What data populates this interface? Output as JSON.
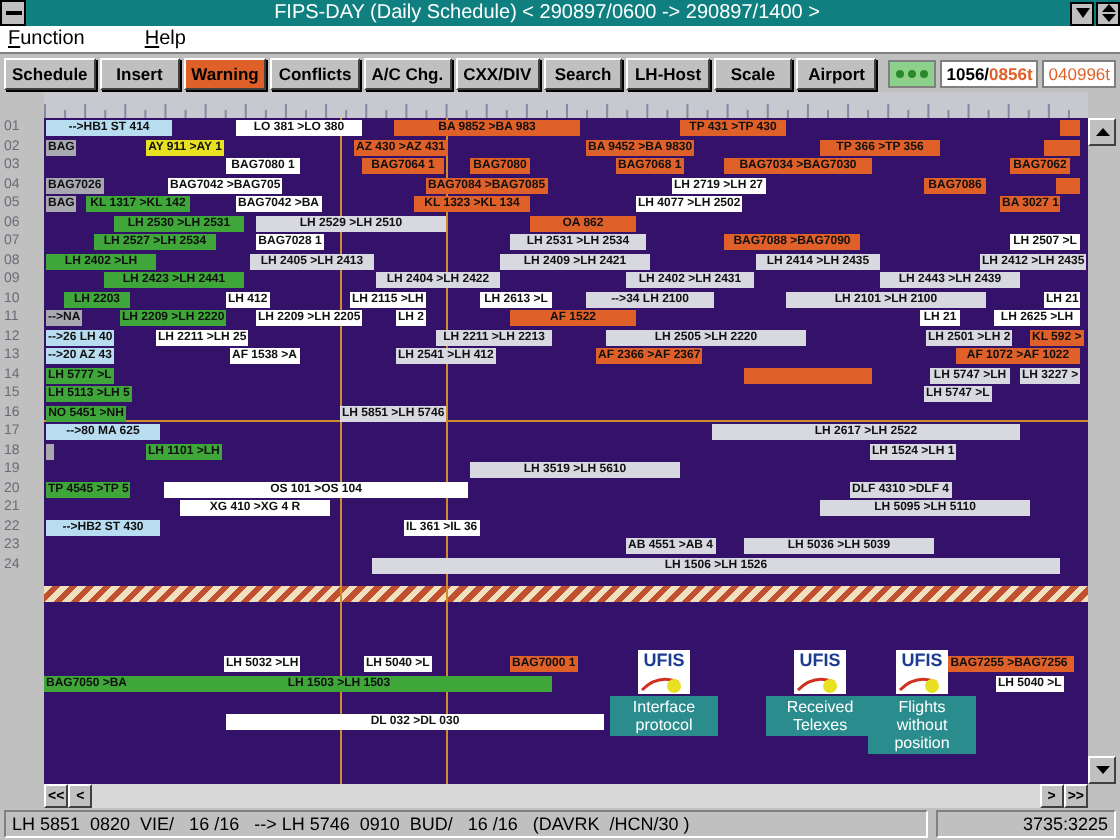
{
  "window": {
    "title": "FIPS-DAY (Daily Schedule) < 290897/0600 -> 290897/1400 >"
  },
  "menu": [
    {
      "label": "Function"
    },
    {
      "label": "Help"
    }
  ],
  "toolbar": {
    "buttons": [
      {
        "label": "Schedule",
        "selected": false
      },
      {
        "label": "Insert",
        "selected": false
      },
      {
        "label": "Warning",
        "selected": true
      },
      {
        "label": "Conflicts",
        "selected": false
      },
      {
        "label": "A/C Chg.",
        "selected": false
      },
      {
        "label": "CXX/DIV",
        "selected": false
      },
      {
        "label": "Search",
        "selected": false
      },
      {
        "label": "LH-Host",
        "selected": false
      },
      {
        "label": "Scale",
        "selected": false
      },
      {
        "label": "Airport",
        "selected": false
      }
    ],
    "counter": "1056/",
    "counter_alert": "0856t",
    "date": "040996t"
  },
  "rows": [
    {
      "label": "01",
      "marked": false,
      "bars": [
        {
          "text": "-->HB1 ST 414",
          "color": "#b8dcf0"
        },
        {
          "text": "LO 381 >LO 380",
          "color": "#ffffff"
        },
        {
          "text": "BA 9852 >BA 983",
          "color": "#e0602a"
        },
        {
          "text": "TP 431 >TP 430",
          "color": "#e0602a"
        },
        {
          "color": "#e0602a"
        }
      ]
    },
    {
      "label": "02",
      "marked": false,
      "bars": [
        {
          "text": "BAG",
          "color": "#a8a8b0"
        },
        {
          "text": "AY 911 >AY 1",
          "color": "#e8e020"
        },
        {
          "text": "AZ 430 >AZ 431",
          "color": "#e0602a"
        },
        {
          "text": "BA 9452 >BA 9830",
          "color": "#e0602a"
        },
        {
          "text": "TP 366 >TP 356",
          "color": "#e0602a"
        },
        {
          "color": "#e0602a"
        }
      ]
    },
    {
      "label": "03",
      "marked": false,
      "bars": [
        {
          "text": "BAG7080 1",
          "color": "#ffffff"
        },
        {
          "text": "BAG7064 1",
          "color": "#e0602a"
        },
        {
          "text": "BAG7080",
          "color": "#e0602a"
        },
        {
          "text": "BAG7068 1",
          "color": "#e0602a"
        },
        {
          "text": "BAG7034 >BAG7030",
          "color": "#e0602a"
        },
        {
          "text": "BAG7062",
          "color": "#e0602a"
        }
      ]
    },
    {
      "label": "04",
      "marked": false,
      "bars": [
        {
          "text": "BAG7026",
          "color": "#a8a8b0"
        },
        {
          "text": "BAG7042 >BAG705",
          "color": "#ffffff"
        },
        {
          "text": "BAG7084 >BAG7085",
          "color": "#e0602a"
        },
        {
          "text": "LH 2719 >LH 27",
          "color": "#ffffff"
        },
        {
          "text": "BAG7086",
          "color": "#e0602a"
        },
        {
          "color": "#e0602a"
        }
      ]
    },
    {
      "label": "05",
      "marked": false,
      "bars": [
        {
          "text": "BAG",
          "color": "#a8a8b0"
        },
        {
          "text": "KL 1317 >KL 142",
          "color": "#3fa63a"
        },
        {
          "text": "BAG7042 >BA",
          "color": "#ffffff"
        },
        {
          "text": "KL 1323 >KL 134",
          "color": "#e0602a"
        },
        {
          "text": "LH 4077 >LH 2502",
          "color": "#ffffff"
        },
        {
          "text": "BA 3027 1",
          "color": "#e0602a"
        }
      ]
    },
    {
      "label": "06",
      "marked": false,
      "bars": [
        {
          "text": "LH 2530 >LH 2531",
          "color": "#3fa63a"
        },
        {
          "text": "LH 2529 >LH 2510",
          "color": "#d8d8e0"
        },
        {
          "text": "OA 862",
          "color": "#e0602a"
        }
      ]
    },
    {
      "label": "07",
      "marked": false,
      "bars": [
        {
          "text": "LH 2527 >LH 2534",
          "color": "#3fa63a"
        },
        {
          "text": "BAG7028 1",
          "color": "#ffffff"
        },
        {
          "text": "LH 2531 >LH 2534",
          "color": "#d8d8e0"
        },
        {
          "text": "BAG7088 >BAG7090",
          "color": "#e0602a"
        },
        {
          "text": "LH 2507 >L",
          "color": "#ffffff"
        }
      ]
    },
    {
      "label": "08",
      "marked": false,
      "bars": [
        {
          "text": "LH 2402 >LH",
          "color": "#3fa63a"
        },
        {
          "text": "LH 2405 >LH 2413",
          "color": "#d8d8e0"
        },
        {
          "text": "LH 2409 >LH 2421",
          "color": "#d8d8e0"
        },
        {
          "text": "LH 2414 >LH 2435",
          "color": "#d8d8e0"
        },
        {
          "text": "LH 2412 >LH 2435",
          "color": "#d8d8e0"
        }
      ]
    },
    {
      "label": "09",
      "marked": false,
      "bars": [
        {
          "text": "LH 2423 >LH 2441",
          "color": "#3fa63a"
        },
        {
          "text": "LH 2404 >LH 2422",
          "color": "#d8d8e0"
        },
        {
          "text": "LH 2402 >LH 2431",
          "color": "#d8d8e0"
        },
        {
          "text": "LH 2443 >LH 2439",
          "color": "#d8d8e0"
        }
      ]
    },
    {
      "label": "10",
      "marked": false,
      "bars": [
        {
          "text": "LH 2203",
          "color": "#3fa63a"
        },
        {
          "text": "LH 412",
          "color": "#ffffff"
        },
        {
          "text": "LH 2115 >LH",
          "color": "#ffffff"
        },
        {
          "text": "LH 2613 >L",
          "color": "#ffffff"
        },
        {
          "text": "-->34 LH 2100",
          "color": "#d8d8e0"
        },
        {
          "text": "LH 2101 >LH 2100",
          "color": "#d8d8e0"
        },
        {
          "text": "LH 21",
          "color": "#ffffff"
        }
      ]
    },
    {
      "label": "11",
      "marked": false,
      "bars": [
        {
          "text": "-->NA",
          "color": "#a8a8b0"
        },
        {
          "text": "LH 2209 >LH 2220",
          "color": "#3fa63a"
        },
        {
          "text": "LH 2209 >LH 2205",
          "color": "#ffffff"
        },
        {
          "text": "LH 2",
          "color": "#ffffff"
        },
        {
          "text": "AF 1522",
          "color": "#e0602a"
        },
        {
          "text": "LH 21",
          "color": "#ffffff"
        },
        {
          "text": "LH 2625 >LH",
          "color": "#ffffff"
        }
      ]
    },
    {
      "label": "12",
      "marked": false,
      "bars": [
        {
          "text": "-->26 LH 40",
          "color": "#b8dcf0"
        },
        {
          "text": "LH 2211 >LH 25",
          "color": "#ffffff"
        },
        {
          "text": "LH 2211 >LH 2213",
          "color": "#d8d8e0"
        },
        {
          "text": "LH 2505 >LH 2220",
          "color": "#d8d8e0"
        },
        {
          "text": "LH 2501 >LH 2",
          "color": "#d8d8e0"
        },
        {
          "text": "KL 592 >",
          "color": "#e0602a"
        }
      ]
    },
    {
      "label": "13",
      "marked": false,
      "bars": [
        {
          "text": "-->20 AZ 43",
          "color": "#b8dcf0"
        },
        {
          "text": "AF 1538 >A",
          "color": "#ffffff"
        },
        {
          "text": "LH 2541 >LH 412",
          "color": "#d8d8e0"
        },
        {
          "text": "AF 2366 >AF 2367",
          "color": "#e0602a"
        },
        {
          "text": "AF 1072 >AF 1022",
          "color": "#e0602a"
        }
      ]
    },
    {
      "label": "14",
      "marked": false,
      "bars": [
        {
          "text": "LH 5777 >L",
          "color": "#3fa63a"
        },
        {
          "color": "#e0602a"
        },
        {
          "text": "LH 5747 >LH",
          "color": "#d8d8e0"
        },
        {
          "text": "LH 3227 >",
          "color": "#d8d8e0"
        }
      ]
    },
    {
      "label": "15",
      "marked": false,
      "bars": [
        {
          "text": "LH 5113 >LH 5",
          "color": "#3fa63a"
        },
        {
          "text": "LH 5747 >L",
          "color": "#d8d8e0"
        }
      ]
    },
    {
      "label": "16",
      "marked": true,
      "bars": [
        {
          "text": "NO 5451 >NH",
          "color": "#3fa63a"
        },
        {
          "text": "LH 5851 >LH 5746",
          "color": "#d8d8e0"
        }
      ]
    },
    {
      "label": "17",
      "marked": false,
      "bars": [
        {
          "text": "-->80 MA 625",
          "color": "#b8dcf0"
        },
        {
          "text": "LH 2617 >LH 2522",
          "color": "#d8d8e0"
        }
      ]
    },
    {
      "label": "18",
      "marked": false,
      "bars": [
        {
          "color": "#a8a8b0"
        },
        {
          "text": "LH 1101 >LH",
          "color": "#3fa63a"
        },
        {
          "text": "LH 1524 >LH 1",
          "color": "#d8d8e0"
        }
      ]
    },
    {
      "label": "19",
      "marked": false,
      "bars": [
        {
          "text": "LH 3519 >LH 5610",
          "color": "#d8d8e0"
        }
      ]
    },
    {
      "label": "20",
      "marked": false,
      "bars": [
        {
          "text": "TP 4545 >TP 5",
          "color": "#3fa63a"
        },
        {
          "text": "OS 101 >OS 104",
          "color": "#ffffff"
        },
        {
          "text": "DLF 4310 >DLF 4",
          "color": "#d8d8e0"
        }
      ]
    },
    {
      "label": "21",
      "marked": false,
      "bars": [
        {
          "text": "XG 410 >XG 4 R",
          "color": "#ffffff"
        },
        {
          "text": "LH 5095 >LH 5110",
          "color": "#d8d8e0"
        }
      ]
    },
    {
      "label": "22",
      "marked": false,
      "bars": [
        {
          "text": "-->HB2 ST 430",
          "color": "#b8dcf0"
        },
        {
          "text": "IL 361 >IL 36",
          "color": "#ffffff"
        }
      ]
    },
    {
      "label": "23",
      "marked": false,
      "bars": [
        {
          "text": "AB 4551 >AB 4",
          "color": "#d8d8e0"
        },
        {
          "text": "LH 5036 >LH 5039",
          "color": "#d8d8e0"
        }
      ]
    },
    {
      "label": "24",
      "marked": false,
      "bars": [
        {
          "text": "LH 1506 >LH 1526",
          "color": "#d8d8e0"
        }
      ]
    }
  ],
  "lower_rows": [
    {
      "bars": [
        {
          "text": "LH 5032 >LH",
          "color": "#ffffff"
        },
        {
          "text": "LH 5040 >L",
          "color": "#ffffff"
        },
        {
          "text": "BAG7000 1",
          "color": "#e0602a"
        },
        {
          "text": "BAG7255 >BAG7256",
          "color": "#e0602a"
        }
      ]
    },
    {
      "bars": [
        {
          "text": "BAG7050 >BA",
          "color": "#3fa63a"
        },
        {
          "text": "LH 1503 >LH 1503",
          "color": "#3fa63a"
        },
        {
          "text": "LH 5040 >L",
          "color": "#ffffff"
        }
      ]
    },
    {
      "bars": [
        {
          "text": "DL 032 >DL 030",
          "color": "#ffffff"
        }
      ]
    }
  ],
  "windows": [
    {
      "logo": "UFIS",
      "title": "Interface protocol"
    },
    {
      "logo": "UFIS",
      "title": "Received Telexes"
    },
    {
      "logo": "UFIS",
      "title": "Flights without position"
    }
  ],
  "scroll_buttons": [
    "<<",
    "<",
    ">",
    ">>"
  ],
  "status_bar": {
    "flight": "LH 5851  0820  VIE/   16 /16   --> LH 5746  0910  BUD/   16 /16   (DAVRK  /HCN/30 )",
    "position": "3735:3225"
  }
}
